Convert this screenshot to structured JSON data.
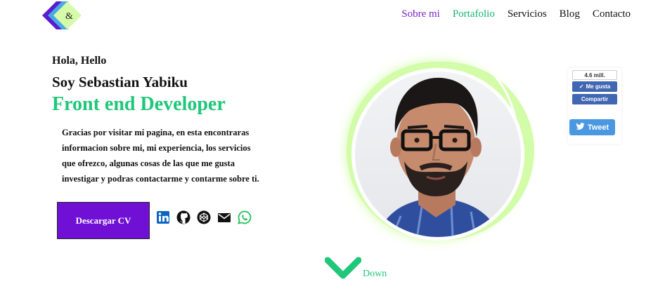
{
  "logo": {
    "glyph": "&"
  },
  "nav": {
    "items": [
      {
        "label": "Sobre mi"
      },
      {
        "label": "Portafolio"
      },
      {
        "label": "Servicios"
      },
      {
        "label": "Blog"
      },
      {
        "label": "Contacto"
      }
    ]
  },
  "hero": {
    "greeting": "Hola, Hello",
    "name": "Soy Sebastian Yabiku",
    "role": "Front end Developer",
    "intro": "Gracias por visitar mi pagina, en esta encontraras informacion sobre mi, mi experiencia, los servicios que ofrezco, algunas cosas de las que me gusta investigar y podras contactarme y contarme sobre ti.",
    "cv_button": "Descargar CV"
  },
  "socials": [
    "linkedin-icon",
    "github-icon",
    "codepen-icon",
    "email-icon",
    "whatsapp-icon"
  ],
  "facebook": {
    "count": "4.6 mill.",
    "like": "Me gusta",
    "share": "Compartir"
  },
  "twitter": {
    "label": "Tweet"
  },
  "scroll": {
    "label": "Down"
  },
  "colors": {
    "purple": "#6f10d4",
    "green": "#1fc779",
    "ring": "#d3fca9"
  }
}
